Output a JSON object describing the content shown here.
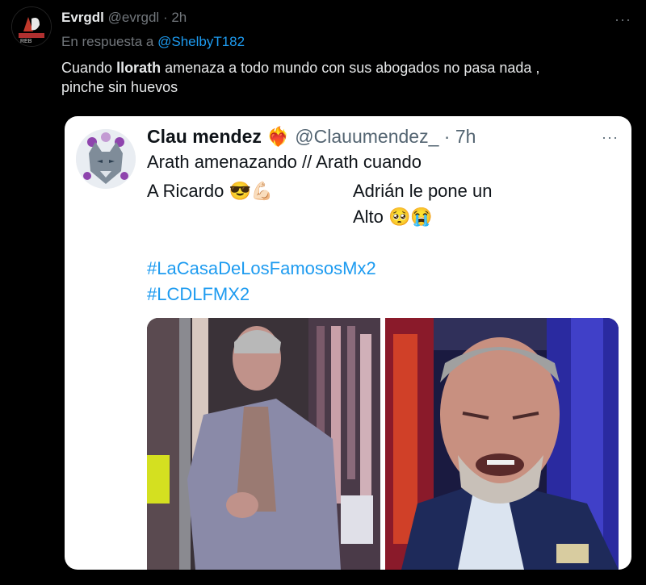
{
  "tweet": {
    "display_name": "Evrgdl",
    "handle": "@evrgdl",
    "time_separator": "·",
    "time": "2h",
    "more_label": "···",
    "reply_prefix": "En respuesta a",
    "reply_to": "@ShelbyT182",
    "text_before": "Cuando ",
    "text_bold": "llorath",
    "text_after": " amenaza a todo mundo con sus abogados no pasa nada ,",
    "text_line2": "pinche sin huevos"
  },
  "quoted": {
    "display_name": "Clau mendez",
    "name_emoji": "❤️‍🔥",
    "handle": "@Clauumendez_",
    "time_separator": "·",
    "time": "7h",
    "more_label": "···",
    "line1": "Arath amenazando  // Arath cuando",
    "line2a": "A Ricardo 😎💪🏻",
    "line2b": "Adrián le pone un",
    "line3": "Alto 🥺😭",
    "hashtag1": "#LaCasaDeLosFamososMx2",
    "hashtag2": "#LCDLFMX2"
  },
  "icons": {
    "avatar": "profile-avatar",
    "quoted_avatar": "wolf-avatar",
    "more": "more-options-icon"
  },
  "colors": {
    "background": "#000000",
    "link": "#1d9bf0",
    "muted": "#71767b",
    "card": "#ffffff"
  }
}
